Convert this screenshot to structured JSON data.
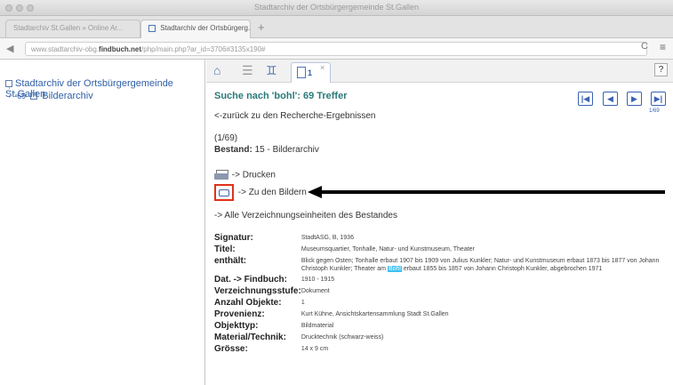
{
  "browser": {
    "window_title": "Stadtarchiv der Ortsbürgergemeinde St.Gallen",
    "tabs": [
      {
        "label": "Stadtarchiv St.Gallen » Online Ar...",
        "active": false
      },
      {
        "label": "Stadtarchiv der Ortsbürgerg...",
        "active": true
      }
    ],
    "new_tab_symbol": "+",
    "url_prefix": "www.stadtarchiv-obg.",
    "url_domain": "findbuch.net",
    "url_path": "/php/main.php?ar_id=3706#3135x190#",
    "reload_symbol": "C",
    "menu_symbol": "≡"
  },
  "tree": {
    "root_label": "Stadtarchiv der Ortsbürgergemeinde St.Gallen",
    "child_count": "69",
    "child_label": "Bilderarchiv"
  },
  "toolbar": {
    "subtab_badge": "1",
    "help_label": "?"
  },
  "result": {
    "title": "Suche nach 'bohl': 69 Treffer",
    "back_link": "<-zurück zu den Recherche-Ergebnissen",
    "count": "(1/69)",
    "bestand_label": "Bestand:",
    "bestand_value": "15 - Bilderarchiv",
    "print_label": "-> Drucken",
    "images_label": "-> Zu den Bildern",
    "all_units_label": "-> Alle Verzeichnungseinheiten des Bestandes",
    "pager_sub": "1/69"
  },
  "fields": {
    "signatur_label": "Signatur:",
    "signatur_value": "StadtASG, B, 1936",
    "titel_label": "Titel:",
    "titel_value": "Museumsquartier, Tonhalle, Natur- und Kunstmuseum, Theater",
    "enthaelt_label": "enthält:",
    "enthaelt_before": "Blick gegen Osten; Tonhalle erbaut 1907 bis 1909 von Julius Kunkler; Natur- und Kunstmuseum erbaut 1873 bis 1877 von Johann Christoph Kunkler; Theater am ",
    "enthaelt_highlight": "Bohl",
    "enthaelt_after": " erbaut 1855 bis 1857 von Johann Christoph Kunkler, abgebrochen 1971",
    "dat_label": "Dat. -> Findbuch:",
    "dat_value": "1910 - 1915",
    "stufe_label": "Verzeichnungsstufe:",
    "stufe_value": "Dokument",
    "anzahl_label": "Anzahl Objekte:",
    "anzahl_value": "1",
    "provenienz_label": "Provenienz:",
    "provenienz_value": "Kurt Kühne, Ansichtskartensammlung Stadt St.Gallen",
    "objekttyp_label": "Objekttyp:",
    "objekttyp_value": "Bildmaterial",
    "material_label": "Material/Technik:",
    "material_value": "Drucktechnik (schwarz-weiss)",
    "groesse_label": "Grösse:",
    "groesse_value": "14 x 9 cm"
  },
  "colors": {
    "link_blue": "#2f5fa8",
    "title_teal": "#2a7a7a",
    "highlight_red": "#e0321b",
    "search_highlight": "#3cc0f0"
  },
  "icons": [
    "home-icon",
    "list-icon",
    "binoculars-icon",
    "document-tab-icon",
    "first-page-icon",
    "previous-page-icon",
    "next-page-icon",
    "last-page-icon",
    "printer-icon",
    "camera-icon",
    "arrow-left-icon"
  ]
}
